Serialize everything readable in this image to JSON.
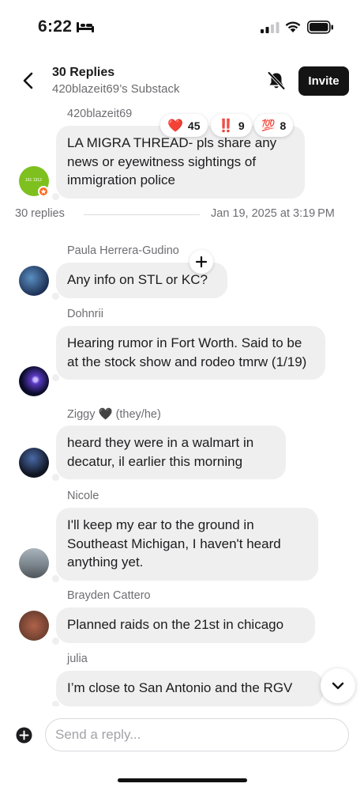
{
  "status_bar": {
    "time": "6:22"
  },
  "header": {
    "title": "30 Replies",
    "subtitle": "420blazeit69’s Substack",
    "invite_label": "Invite"
  },
  "op": {
    "author": "420blazeit69",
    "avatar_text": "161 1312",
    "text": "LA MIGRA THREAD- pls share any news or eyewitness sightings of immigration police",
    "reactions": [
      {
        "emoji": "❤️",
        "count": "45"
      },
      {
        "emoji": "‼️",
        "count": "9"
      },
      {
        "emoji": "💯",
        "count": "8"
      }
    ],
    "reply_count": "30 replies",
    "date": "Jan 19, 2025 at 3:19 PM"
  },
  "replies": [
    {
      "author": "Paula Herrera-Gudino",
      "text": "Any info on STL or KC?"
    },
    {
      "author": "Dohnrii",
      "text": "Hearing rumor in Fort Worth. Said to be at the stock show and rodeo tmrw (1/19)"
    },
    {
      "author": "Ziggy 🖤  (they/he)",
      "text": "heard they were in a walmart in decatur, il earlier this morning"
    },
    {
      "author": "Nicole",
      "text": "I'll keep my ear to the ground in Southeast Michigan, I haven't heard anything yet."
    },
    {
      "author": "Brayden Cattero",
      "text": "Planned raids on the 21st in chicago"
    },
    {
      "author": "julia",
      "text": "I’m close to San Antonio and the RGV"
    }
  ],
  "composer": {
    "placeholder": "Send a reply..."
  },
  "colors": {
    "accent_dark": "#141414",
    "bubble": "#efeff0",
    "meta": "#6e6e73"
  },
  "icons": [
    "bed-icon",
    "signal-icon",
    "wifi-icon",
    "battery-icon",
    "back-chevron-icon",
    "bell-off-icon",
    "plus-icon",
    "chevron-down-icon",
    "add-circle-icon"
  ]
}
